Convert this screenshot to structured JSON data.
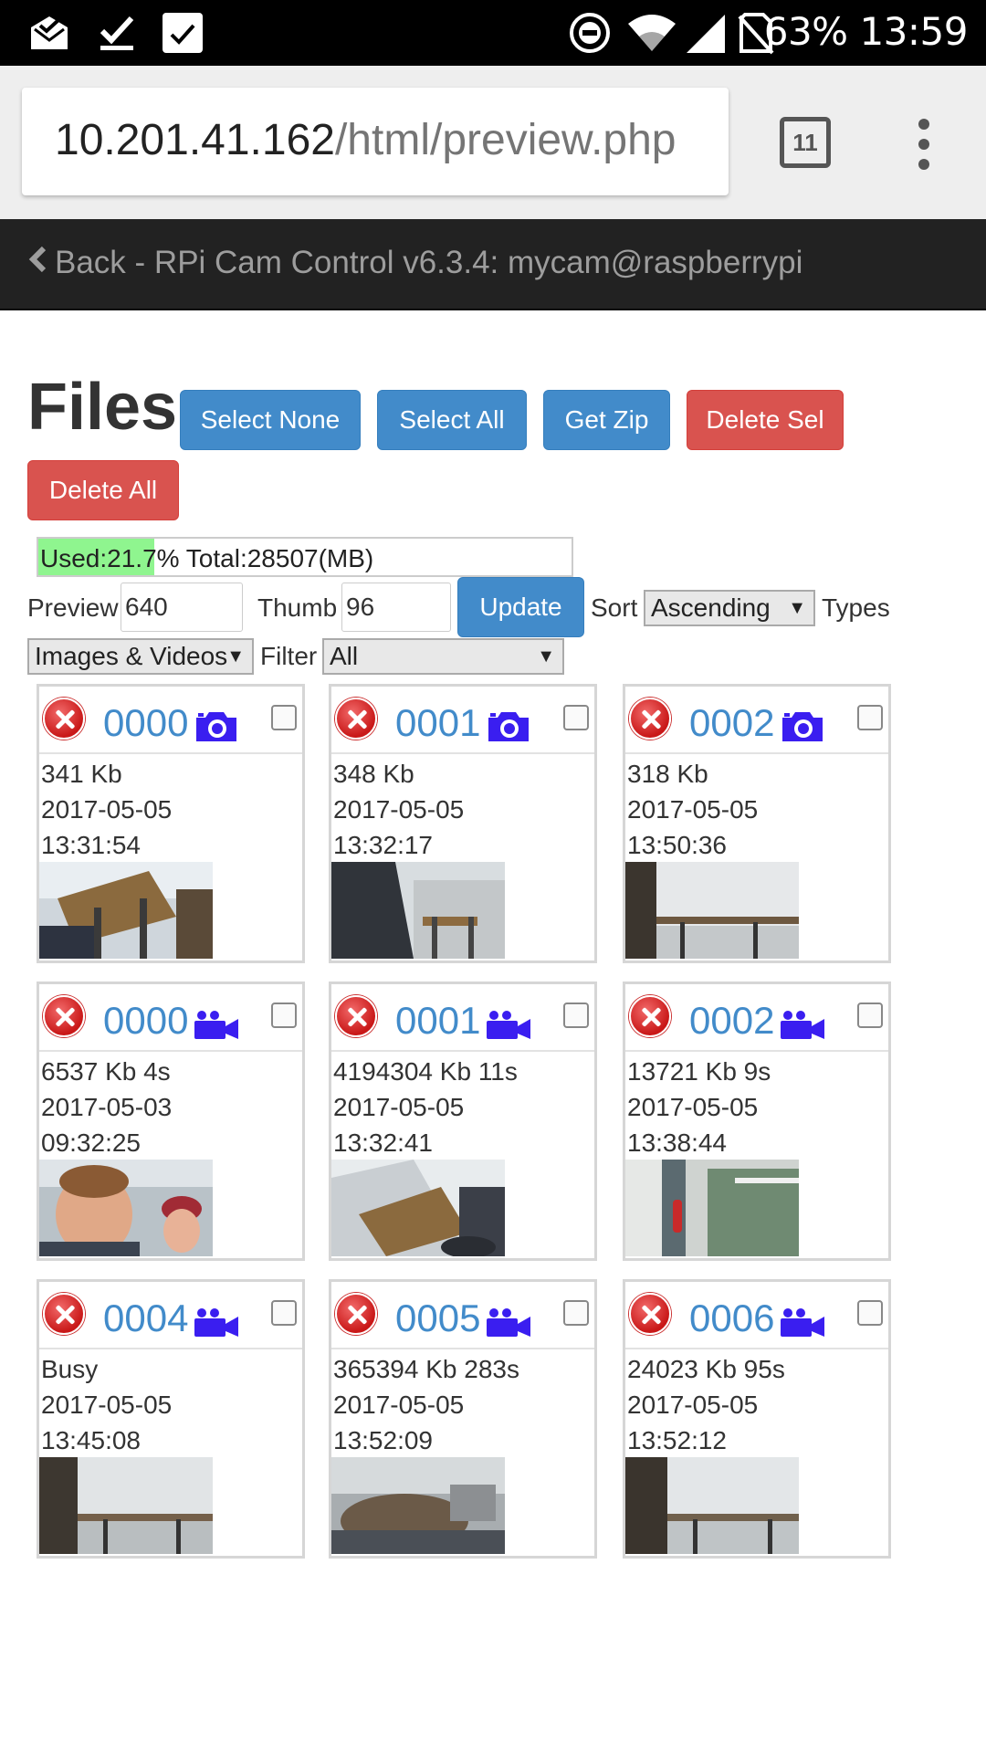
{
  "status_bar": {
    "battery": "63%",
    "time": "13:59",
    "icons": [
      "mail-done-icon",
      "download-done-icon",
      "check-box-icon",
      "do-not-disturb-icon",
      "wifi-icon",
      "signal-icon",
      "no-sim-icon"
    ]
  },
  "browser": {
    "url_host": "10.201.41.162",
    "url_path": "/html/preview.php",
    "tab_count": "11"
  },
  "nav": {
    "back_label": "Back - RPi Cam Control v6.3.4: mycam@raspberrypi"
  },
  "page": {
    "title": "Files",
    "buttons": {
      "select_none": "Select None",
      "select_all": "Select All",
      "get_zip": "Get Zip",
      "delete_sel": "Delete Sel",
      "delete_all": "Delete All"
    },
    "usage": {
      "text": "Used:21.7% Total:28507(MB)",
      "used_fraction": 0.217
    },
    "settings": {
      "preview_label": "Preview",
      "preview_value": "640",
      "thumb_label": "Thumb",
      "thumb_value": "96",
      "update_label": "Update",
      "sort_label": "Sort",
      "sort_value": "Ascending",
      "types_label": "Types",
      "types_value": "Images & Videos",
      "filter_label": "Filter",
      "filter_value": "All"
    }
  },
  "files": [
    {
      "name": "0000",
      "type": "image",
      "size": "341 Kb",
      "date": "2017-05-05",
      "time": "13:31:54"
    },
    {
      "name": "0001",
      "type": "image",
      "size": "348 Kb",
      "date": "2017-05-05",
      "time": "13:32:17"
    },
    {
      "name": "0002",
      "type": "image",
      "size": "318 Kb",
      "date": "2017-05-05",
      "time": "13:50:36"
    },
    {
      "name": "0000",
      "type": "video",
      "size": "6537 Kb 4s",
      "date": "2017-05-03",
      "time": "09:32:25"
    },
    {
      "name": "0001",
      "type": "video",
      "size": "4194304 Kb 11s",
      "date": "2017-05-05",
      "time": "13:32:41"
    },
    {
      "name": "0002",
      "type": "video",
      "size": "13721 Kb 9s",
      "date": "2017-05-05",
      "time": "13:38:44"
    },
    {
      "name": "0004",
      "type": "video",
      "size": "Busy",
      "date": "2017-05-05",
      "time": "13:45:08"
    },
    {
      "name": "0005",
      "type": "video",
      "size": "365394 Kb 283s",
      "date": "2017-05-05",
      "time": "13:52:09"
    },
    {
      "name": "0006",
      "type": "video",
      "size": "24023 Kb 95s",
      "date": "2017-05-05",
      "time": "13:52:12"
    }
  ],
  "colors": {
    "link_blue": "#428bca",
    "danger_red": "#d9534f",
    "icon_purple": "#3a1ef0",
    "usage_green": "#8ff58f",
    "navbar": "#222222"
  }
}
